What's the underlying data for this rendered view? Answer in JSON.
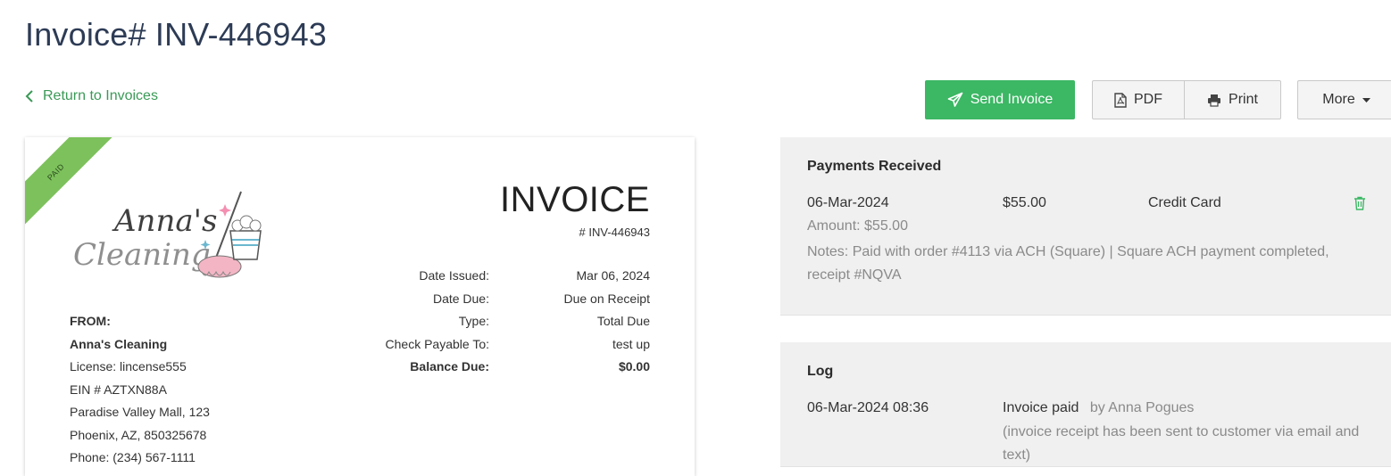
{
  "page": {
    "title": "Invoice# INV-446943",
    "back_link": "Return to Invoices"
  },
  "toolbar": {
    "send_label": "Send Invoice",
    "pdf_label": "PDF",
    "print_label": "Print",
    "more_label": "More"
  },
  "colors": {
    "accent_green": "#3cb764",
    "link_green": "#3a9a57",
    "ribbon_green": "#7dc15c",
    "title_navy": "#2d3b55"
  },
  "invoice": {
    "status_ribbon": "PAID",
    "logo_text": [
      "Anna's",
      "Cleaning"
    ],
    "heading": "INVOICE",
    "number": "# INV-446943",
    "meta": [
      {
        "label": "Date Issued:",
        "value": "Mar 06, 2024"
      },
      {
        "label": "Date Due:",
        "value": "Due on Receipt"
      },
      {
        "label": "Type:",
        "value": "Total Due"
      },
      {
        "label": "Check Payable To:",
        "value": "test up"
      },
      {
        "label": "Balance Due:",
        "value": "$0.00"
      }
    ],
    "from": {
      "heading": "FROM:",
      "name": "Anna's Cleaning",
      "license": "License: lincense555",
      "ein": "EIN # AZTXN88A",
      "address1": "Paradise Valley Mall, 123",
      "address2": "Phoenix, AZ, 850325678",
      "phone": "Phone: (234) 567-1111"
    }
  },
  "payments": {
    "title": "Payments Received",
    "items": [
      {
        "date": "06-Mar-2024",
        "amount": "$55.00",
        "method": "Credit Card",
        "amount_line": "Amount: $55.00",
        "notes": "Notes: Paid with order #4113 via ACH (Square) | Square ACH payment completed, receipt #NQVA"
      }
    ]
  },
  "log": {
    "title": "Log",
    "items": [
      {
        "timestamp": "06-Mar-2024 08:36",
        "event": "Invoice paid",
        "by": "by Anna Pogues",
        "detail": "(invoice receipt has been sent to customer via email and text)"
      }
    ]
  }
}
